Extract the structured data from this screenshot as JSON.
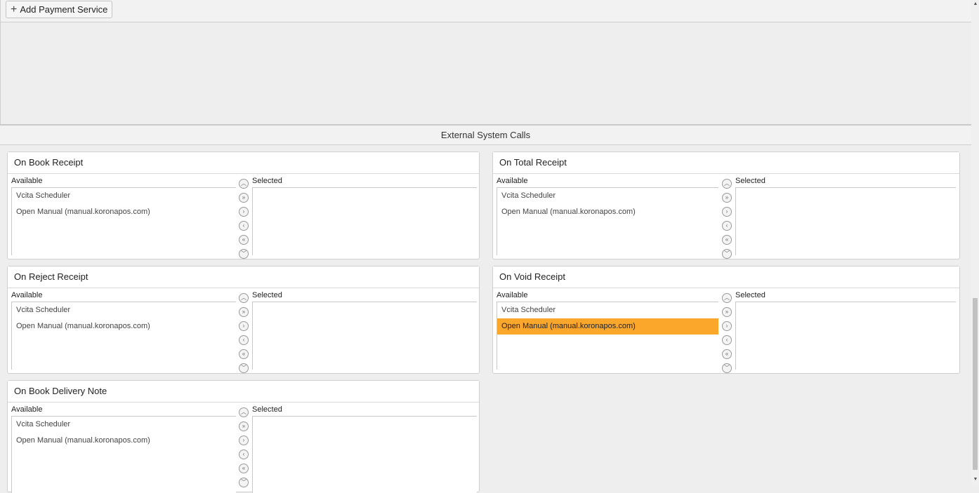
{
  "toolbar": {
    "add_payment_service_label": "Add Payment Service"
  },
  "section": {
    "title": "External System Calls"
  },
  "panels": [
    {
      "title": "On Book Receipt",
      "available_label": "Available",
      "selected_label": "Selected",
      "available": [
        "Vcita Scheduler",
        "Open Manual (manual.koronapos.com)"
      ],
      "selected": []
    },
    {
      "title": "On Total Receipt",
      "available_label": "Available",
      "selected_label": "Selected",
      "available": [
        "Vcita Scheduler",
        "Open Manual (manual.koronapos.com)"
      ],
      "selected": []
    },
    {
      "title": "On Reject Receipt",
      "available_label": "Available",
      "selected_label": "Selected",
      "available": [
        "Vcita Scheduler",
        "Open Manual (manual.koronapos.com)"
      ],
      "selected": []
    },
    {
      "title": "On Void Receipt",
      "available_label": "Available",
      "selected_label": "Selected",
      "available": [
        "Vcita Scheduler",
        "Open Manual (manual.koronapos.com)"
      ],
      "selected": [],
      "highlighted_available": "Open Manual (manual.koronapos.com)"
    },
    {
      "title": "On Book Delivery Note",
      "available_label": "Available",
      "selected_label": "Selected",
      "available": [
        "Vcita Scheduler",
        "Open Manual (manual.koronapos.com)"
      ],
      "selected": []
    }
  ],
  "colors": {
    "highlight": "#fba72b",
    "background": "#eeeeee"
  },
  "icons": [
    "plus-icon",
    "move-top-icon",
    "move-all-right-icon",
    "move-right-icon",
    "move-left-icon",
    "move-all-left-icon",
    "move-bottom-icon"
  ]
}
